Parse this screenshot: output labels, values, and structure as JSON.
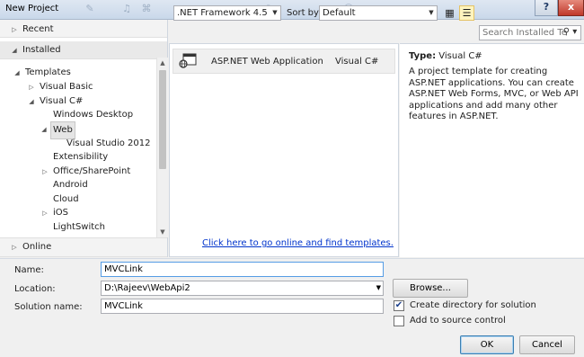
{
  "window": {
    "title": "New Project",
    "help_label": "?",
    "close_label": "x"
  },
  "tree": {
    "recent": "Recent",
    "installed": "Installed",
    "templates": "Templates",
    "visual_basic": "Visual Basic",
    "visual_csharp": "Visual C#",
    "windows_desktop": "Windows Desktop",
    "web": "Web",
    "visual_studio_2012": "Visual Studio 2012",
    "extensibility": "Extensibility",
    "office_sharepoint": "Office/SharePoint",
    "android": "Android",
    "cloud": "Cloud",
    "ios": "iOS",
    "lightswitch": "LightSwitch",
    "online": "Online"
  },
  "toolbar": {
    "framework": ".NET Framework 4.5",
    "sort_label": "Sort by:",
    "sort_value": "Default",
    "search_placeholder": "Search Installed Te"
  },
  "templates": [
    {
      "name": "ASP.NET Web Application",
      "language": "Visual C#"
    }
  ],
  "online_link": "Click here to go online and find templates.",
  "details": {
    "type_key": "Type:",
    "type_value": "Visual C#",
    "description": "A project template for creating ASP.NET applications. You can create ASP.NET Web Forms, MVC,  or Web API applications and add many other features in ASP.NET."
  },
  "form": {
    "name_label": "Name:",
    "name_value": "MVCLink",
    "location_label": "Location:",
    "location_value": "D:\\Rajeev\\WebApi2",
    "solution_label": "Solution name:",
    "solution_value": "MVCLink",
    "browse_label": "Browse...",
    "create_dir_label": "Create directory for solution",
    "create_dir_checked": true,
    "source_control_label": "Add to source control",
    "source_control_checked": false,
    "ok_label": "OK",
    "cancel_label": "Cancel"
  },
  "colors": {
    "link": "#0033cc",
    "selection": "#e5e5e5",
    "focus_border": "#569de5"
  }
}
